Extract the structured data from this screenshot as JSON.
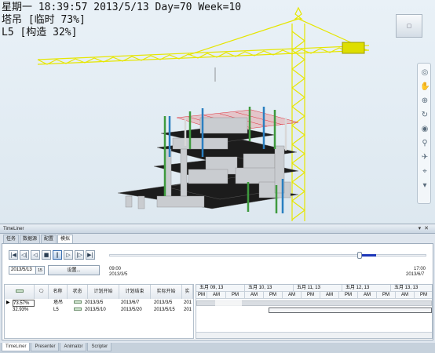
{
  "viewport": {
    "overlay_line1": "星期一 18:39:57 2013/5/13 Day=70 Week=10",
    "overlay_line2": "塔吊 [临时 73%]",
    "overlay_line3": "L5 [构造 32%]"
  },
  "timeliner": {
    "title": "TimeLiner",
    "tabs": [
      "任务",
      "数据源",
      "配置",
      "模拟"
    ],
    "active_tab": "模拟",
    "date_value": "2013/5/13",
    "settings_label": "设置...",
    "range_start_time": "09:00",
    "range_start_date": "2013/3/5",
    "range_end_time": "17:00",
    "range_end_date": "2013/6/7",
    "progress_fraction": 0.79,
    "columns": [
      "名称",
      "状态",
      "计划开始",
      "计划结束",
      "实际开始",
      "实"
    ],
    "rows": [
      {
        "progress": "73.57%",
        "name": "塔吊",
        "plan_start": "2013/3/5",
        "plan_end": "2013/6/7",
        "actual_start": "2013/3/5",
        "actual_end": "201"
      },
      {
        "progress": "32.93%",
        "name": "L5",
        "plan_start": "2013/5/10",
        "plan_end": "2013/5/20",
        "actual_start": "2013/5/15",
        "actual_end": "201"
      }
    ],
    "gantt_days": [
      "五月 09, 13",
      "五月 10, 13",
      "五月 11, 13",
      "五月 12, 13",
      "五月 13, 13"
    ],
    "am_label": "AM",
    "pm_label": "PM",
    "bottom_tabs": [
      "TimeLiner",
      "Presenter",
      "Animator",
      "Scripter"
    ]
  }
}
